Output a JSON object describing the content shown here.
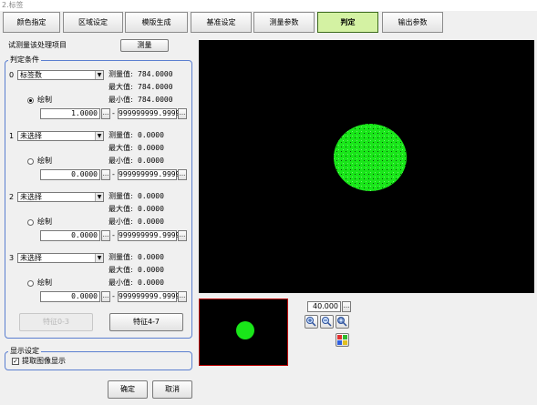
{
  "window": {
    "title": "2.标签"
  },
  "tabs": [
    {
      "label": "颜色指定"
    },
    {
      "label": "区域设定"
    },
    {
      "label": "模版生成"
    },
    {
      "label": "基准设定"
    },
    {
      "label": "测量参数"
    },
    {
      "label": "判定"
    },
    {
      "label": "输出参数"
    }
  ],
  "active_tab": "判定",
  "panel": {
    "test_label": "试测量该处理项目",
    "measure_button": "测量",
    "judge_group_label": "判定条件",
    "conditions": [
      {
        "index": "0",
        "select": "标签数",
        "measured_label": "测量值:",
        "measured": "784.0000",
        "max_label": "最大值:",
        "max": "784.0000",
        "min_label": "最小值:",
        "min": "784.0000",
        "radio_label": "绘制",
        "low": "1.0000",
        "high": "999999999.9999"
      },
      {
        "index": "1",
        "select": "未选择",
        "measured_label": "测量值:",
        "measured": "0.0000",
        "max_label": "最大值:",
        "max": "0.0000",
        "min_label": "最小值:",
        "min": "0.0000",
        "radio_label": "绘制",
        "low": "0.0000",
        "high": "999999999.9999"
      },
      {
        "index": "2",
        "select": "未选择",
        "measured_label": "测量值:",
        "measured": "0.0000",
        "max_label": "最大值:",
        "max": "0.0000",
        "min_label": "最小值:",
        "min": "0.0000",
        "radio_label": "绘制",
        "low": "0.0000",
        "high": "999999999.9999"
      },
      {
        "index": "3",
        "select": "未选择",
        "measured_label": "测量值:",
        "measured": "0.0000",
        "max_label": "最大值:",
        "max": "0.0000",
        "min_label": "最小值:",
        "min": "0.0000",
        "radio_label": "绘制",
        "low": "0.0000",
        "high": "999999999.9999"
      }
    ],
    "dash": "-",
    "dots": "...",
    "feature_0_3_button": "特征0-3",
    "feature_4_7_button": "特征4-7",
    "display_group_label": "显示设定",
    "extract_image_label": "提取图像显示",
    "extract_image_checked": "✓",
    "ok_button": "确定",
    "cancel_button": "取消"
  },
  "viewer": {
    "zoom_value": "40.000",
    "blob_color": "#19e619",
    "background": "#000000"
  },
  "colors": {
    "active_tab": "#d4f2a3",
    "group_border": "#5b7fd0",
    "thumb_border": "#bb0000"
  }
}
